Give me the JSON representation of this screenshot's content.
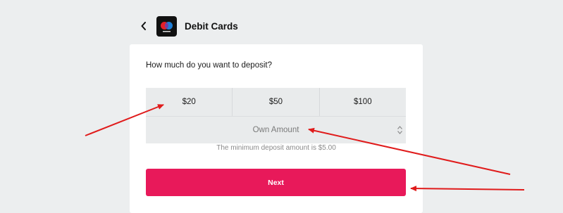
{
  "header": {
    "title": "Debit Cards",
    "back_icon": "chevron-left-icon",
    "logo_icon": "debit-card-logo"
  },
  "deposit": {
    "question": "How much do you want to deposit?",
    "amounts": [
      "$20",
      "$50",
      "$100"
    ],
    "own_amount_placeholder": "Own Amount",
    "minimum_hint": "The minimum deposit amount is $5.00",
    "next_label": "Next"
  },
  "colors": {
    "accent": "#e8195a",
    "background": "#eceeef",
    "panel": "#ffffff",
    "option_fill": "#e9ebec",
    "annotation_arrow": "#e01b1b"
  },
  "annotations": {
    "arrow_count": 3,
    "arrow_targets": [
      "amount-20-button",
      "own-amount-input",
      "next-button"
    ]
  }
}
